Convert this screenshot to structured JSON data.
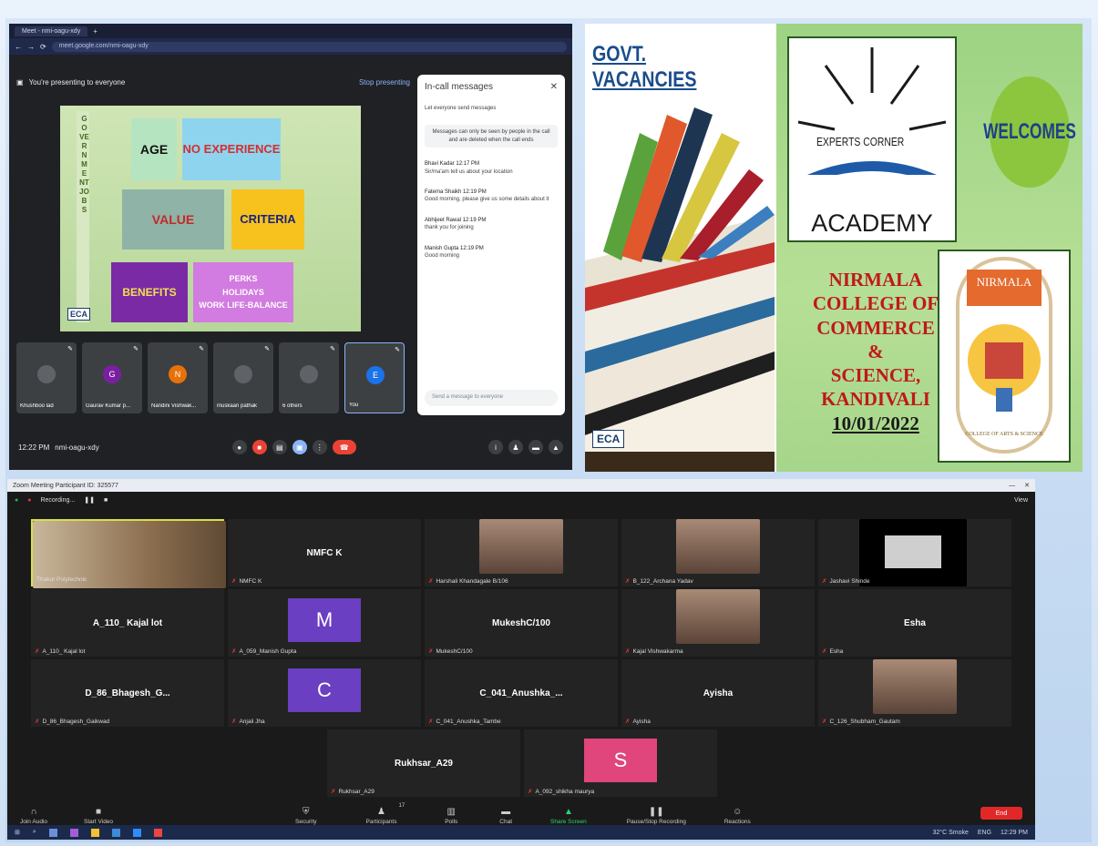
{
  "meet": {
    "tab": "Meet - nmi-oagu-xdy",
    "url": "meet.google.com/nmi-oagu-xdy",
    "presenting": "You're presenting to everyone",
    "stop": "Stop presenting",
    "time": "12:22 PM",
    "code": "nmi-oagu-xdy",
    "slide": {
      "vertical": "GOVERNMENT JOBS",
      "age": "AGE",
      "noexp": "NO EXPERIENCE",
      "value": "VALUE",
      "criteria": "CRITERIA",
      "benefits": "BENEFITS",
      "perks": "PERKS",
      "holidays": "HOLIDAYS",
      "wlb": "WORK LIFE-BALANCE",
      "logo": "ECA"
    },
    "tiles": [
      {
        "name": "Khushboo lad",
        "initial": "",
        "color": "#5f6368"
      },
      {
        "name": "Gaurav Kumar p...",
        "initial": "G",
        "color": "#7b1fa2"
      },
      {
        "name": "Nandini Vishwak...",
        "initial": "N",
        "color": "#e8710a"
      },
      {
        "name": "muskaan pathak",
        "initial": "",
        "color": "#5f6368"
      },
      {
        "name": "6 others",
        "initial": "",
        "color": "#5f6368"
      },
      {
        "name": "You",
        "initial": "E",
        "color": "#1a73e8"
      }
    ],
    "chat": {
      "title": "In-call messages",
      "toggle": "Let everyone send messages",
      "notice": "Messages can only be seen by people in the call and are deleted when the call ends",
      "messages": [
        {
          "from": "Bhavi Kadar 12:17 PM",
          "text": "Sir/ma'am tell us about your location"
        },
        {
          "from": "Fatema Shaikh 12:19 PM",
          "text": "Good morning, please give us some details about it"
        },
        {
          "from": "Abhijeet Rawal 12:19 PM",
          "text": "thank you for joining"
        },
        {
          "from": "Manish Gupta 12:19 PM",
          "text": "Good morning"
        }
      ],
      "placeholder": "Send a message to everyone"
    }
  },
  "poster": {
    "govt": "GOVT. VACANCIES",
    "eca": "ECA",
    "expert": "EXPERTS CORNER",
    "academy": "ACADEMY",
    "welcomes": "WELCOMES",
    "college": [
      "NIRMALA",
      "COLLEGE OF",
      "COMMERCE &",
      "SCIENCE,",
      "KANDIVALI"
    ],
    "date": "10/01/2022",
    "crest_top": "NIRMALA",
    "crest_ring": "COLLEGE OF ARTS & SCIENCE"
  },
  "zoom": {
    "title": "Zoom Meeting Participant ID: 325577",
    "recording": "Recording...",
    "view": "View",
    "participants": [
      {
        "center": "",
        "label": "Thakur Polytechnic",
        "kind": "photo"
      },
      {
        "center": "NMFC K",
        "label": "NMFC K",
        "kind": "text"
      },
      {
        "center": "",
        "label": "Harshali Khandagale B/106",
        "kind": "photo"
      },
      {
        "center": "",
        "label": "B_122_Archana Yadav",
        "kind": "photo"
      },
      {
        "center": "",
        "label": "Jashavi Shinde",
        "kind": "dark"
      },
      {
        "center": "A_110_ Kajal lot",
        "label": "A_110_ Kajal lot",
        "kind": "text"
      },
      {
        "center": "M",
        "label": "A_059_Manish Gupta",
        "kind": "avatar",
        "color": "#6a3fc1"
      },
      {
        "center": "MukeshC/100",
        "label": "MukeshC/100",
        "kind": "text"
      },
      {
        "center": "",
        "label": "Kajal Vishwakarma",
        "kind": "photo"
      },
      {
        "center": "Esha",
        "label": "Esha",
        "kind": "text"
      },
      {
        "center": "D_86_Bhagesh_G...",
        "label": "D_86_Bhagesh_Gaikwad",
        "kind": "text"
      },
      {
        "center": "C",
        "label": "Anjali Jha",
        "kind": "avatar",
        "color": "#6a3fc1"
      },
      {
        "center": "C_041_Anushka_...",
        "label": "C_041_Anushka_Tambe",
        "kind": "text"
      },
      {
        "center": "Ayisha",
        "label": "Ayisha",
        "kind": "text"
      },
      {
        "center": "",
        "label": "C_126_Shubham_Gautam",
        "kind": "photo"
      },
      {
        "center": "Rukhsar_A29",
        "label": "Rukhsar_A29",
        "kind": "text"
      },
      {
        "center": "S",
        "label": "A_092_shikha maurya",
        "kind": "avatar",
        "color": "#e0457b"
      }
    ],
    "toolbar": [
      {
        "label": "Join Audio",
        "icon": "headphones-icon"
      },
      {
        "label": "Start Video",
        "icon": "video-icon"
      },
      {
        "label": "Security",
        "icon": "shield-icon"
      },
      {
        "label": "Participants",
        "icon": "people-icon"
      },
      {
        "label": "Polls",
        "icon": "poll-icon"
      },
      {
        "label": "Chat",
        "icon": "chat-icon"
      },
      {
        "label": "Share Screen",
        "icon": "share-icon"
      },
      {
        "label": "Pause/Stop Recording",
        "icon": "record-icon"
      },
      {
        "label": "Reactions",
        "icon": "smile-icon"
      }
    ],
    "end": "End",
    "participants_count": "17",
    "taskbar": {
      "weather": "32°C Smoke",
      "lang": "ENG",
      "time": "12:29 PM"
    }
  }
}
